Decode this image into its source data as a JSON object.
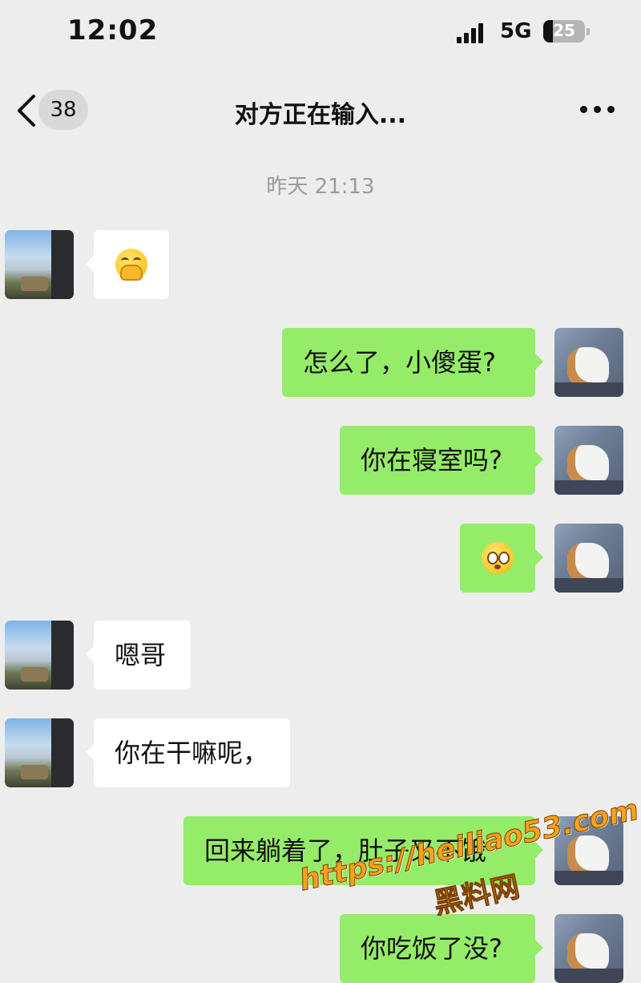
{
  "status_bar": {
    "time": "12:02",
    "network": "5G",
    "battery": "25"
  },
  "nav": {
    "unread_count": "38",
    "title": "对方正在输入..."
  },
  "chat": {
    "timestamp": "昨天 21:13",
    "messages": [
      {
        "side": "left",
        "type": "emoji",
        "emoji": "hand-over-mouth-emoji"
      },
      {
        "side": "right",
        "type": "text",
        "text": "怎么了，小傻蛋?"
      },
      {
        "side": "right",
        "type": "text",
        "text": "你在寝室吗?"
      },
      {
        "side": "right",
        "type": "emoji",
        "emoji": "pleading-face-emoji"
      },
      {
        "side": "left",
        "type": "text",
        "text": "嗯哥"
      },
      {
        "side": "left",
        "type": "text",
        "text": "你在干嘛呢，"
      },
      {
        "side": "right",
        "type": "text",
        "text": "回来躺着了，肚子又不饿"
      },
      {
        "side": "right",
        "type": "text",
        "text": "你吃饭了没?"
      }
    ]
  },
  "watermark": {
    "url": "https://heiliao53.com",
    "name": "黑料网"
  },
  "colors": {
    "bubble_self": "#95ec69",
    "bubble_other": "#ffffff",
    "background": "#ededed"
  }
}
